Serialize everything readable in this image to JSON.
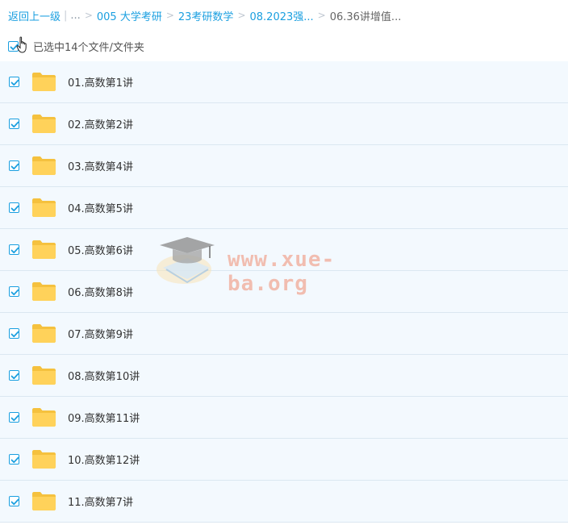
{
  "breadcrumb": {
    "back": "返回上一级",
    "ellipsis": "...",
    "items": [
      "005 大学考研",
      "23考研数学",
      "08.2023强..."
    ],
    "current": "06.36讲增值..."
  },
  "selection": {
    "label": "已选中14个文件/文件夹",
    "checked": true
  },
  "files": [
    {
      "name": "01.高数第1讲",
      "checked": true
    },
    {
      "name": "02.高数第2讲",
      "checked": true
    },
    {
      "name": "03.高数第4讲",
      "checked": true
    },
    {
      "name": "04.高数第5讲",
      "checked": true
    },
    {
      "name": "05.高数第6讲",
      "checked": true
    },
    {
      "name": "06.高数第8讲",
      "checked": true
    },
    {
      "name": "07.高数第9讲",
      "checked": true
    },
    {
      "name": "08.高数第10讲",
      "checked": true
    },
    {
      "name": "09.高数第11讲",
      "checked": true
    },
    {
      "name": "10.高数第12讲",
      "checked": true
    },
    {
      "name": "11.高数第7讲",
      "checked": true
    }
  ],
  "watermark": {
    "text": "www.xue-ba.org"
  },
  "icons": {
    "checkbox": "checkbox-checked-icon",
    "folder": "folder-icon",
    "cursor": "hand-cursor-icon",
    "logo": "graduation-cap-icon"
  },
  "colors": {
    "accent": "#1a9fe0",
    "folder": "#ffd25a",
    "row_bg": "#f3f9fe"
  }
}
